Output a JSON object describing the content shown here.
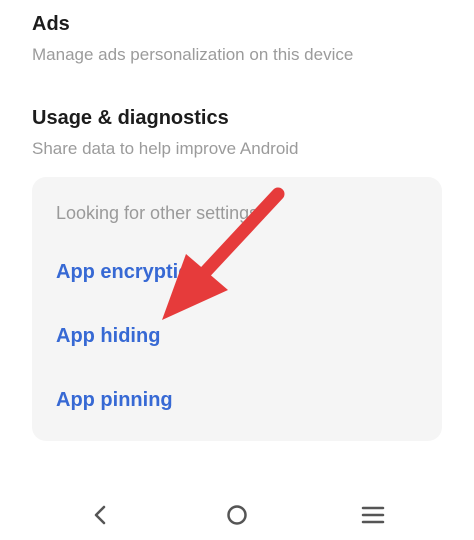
{
  "settings": {
    "ads": {
      "title": "Ads",
      "subtitle": "Manage ads personalization on this device"
    },
    "usage": {
      "title": "Usage & diagnostics",
      "subtitle": "Share data to help improve Android"
    }
  },
  "card": {
    "heading": "Looking for other settings?",
    "links": [
      "App encryption",
      "App hiding",
      "App pinning"
    ]
  },
  "annotation": {
    "arrow_color": "#e63b3b",
    "icon": "red-arrow-icon"
  },
  "nav": {
    "back_icon": "back-icon",
    "home_icon": "home-icon",
    "menu_icon": "menu-icon"
  },
  "colors": {
    "link": "#3769d4",
    "title": "#1c1c1c",
    "subtitle": "#9b9b9b",
    "card_bg": "#f5f5f5"
  }
}
